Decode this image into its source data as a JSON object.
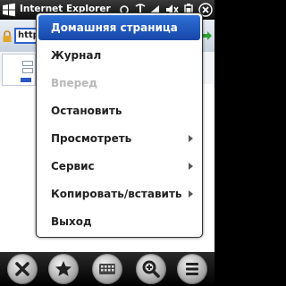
{
  "window": {
    "title": "Internet Explorer"
  },
  "address_bar": {
    "url_text": "http"
  },
  "menu": {
    "items": [
      {
        "label": "Домашняя страница",
        "state": "selected",
        "submenu": false
      },
      {
        "label": "Журнал",
        "state": "normal",
        "submenu": false
      },
      {
        "label": "Вперед",
        "state": "disabled",
        "submenu": false
      },
      {
        "label": "Остановить",
        "state": "normal",
        "submenu": false
      },
      {
        "label": "Просмотреть",
        "state": "normal",
        "submenu": true
      },
      {
        "label": "Сервис",
        "state": "normal",
        "submenu": true
      },
      {
        "label": "Копировать/вставить",
        "state": "normal",
        "submenu": true
      },
      {
        "label": "Выход",
        "state": "normal",
        "submenu": false
      }
    ]
  },
  "toolbar": {
    "buttons": [
      "close-icon",
      "star-icon",
      "keyboard-icon",
      "zoom-icon",
      "menu-icon"
    ]
  },
  "colors": {
    "selection": "#1f5cc4",
    "disabled_text": "#b9b9b9"
  }
}
